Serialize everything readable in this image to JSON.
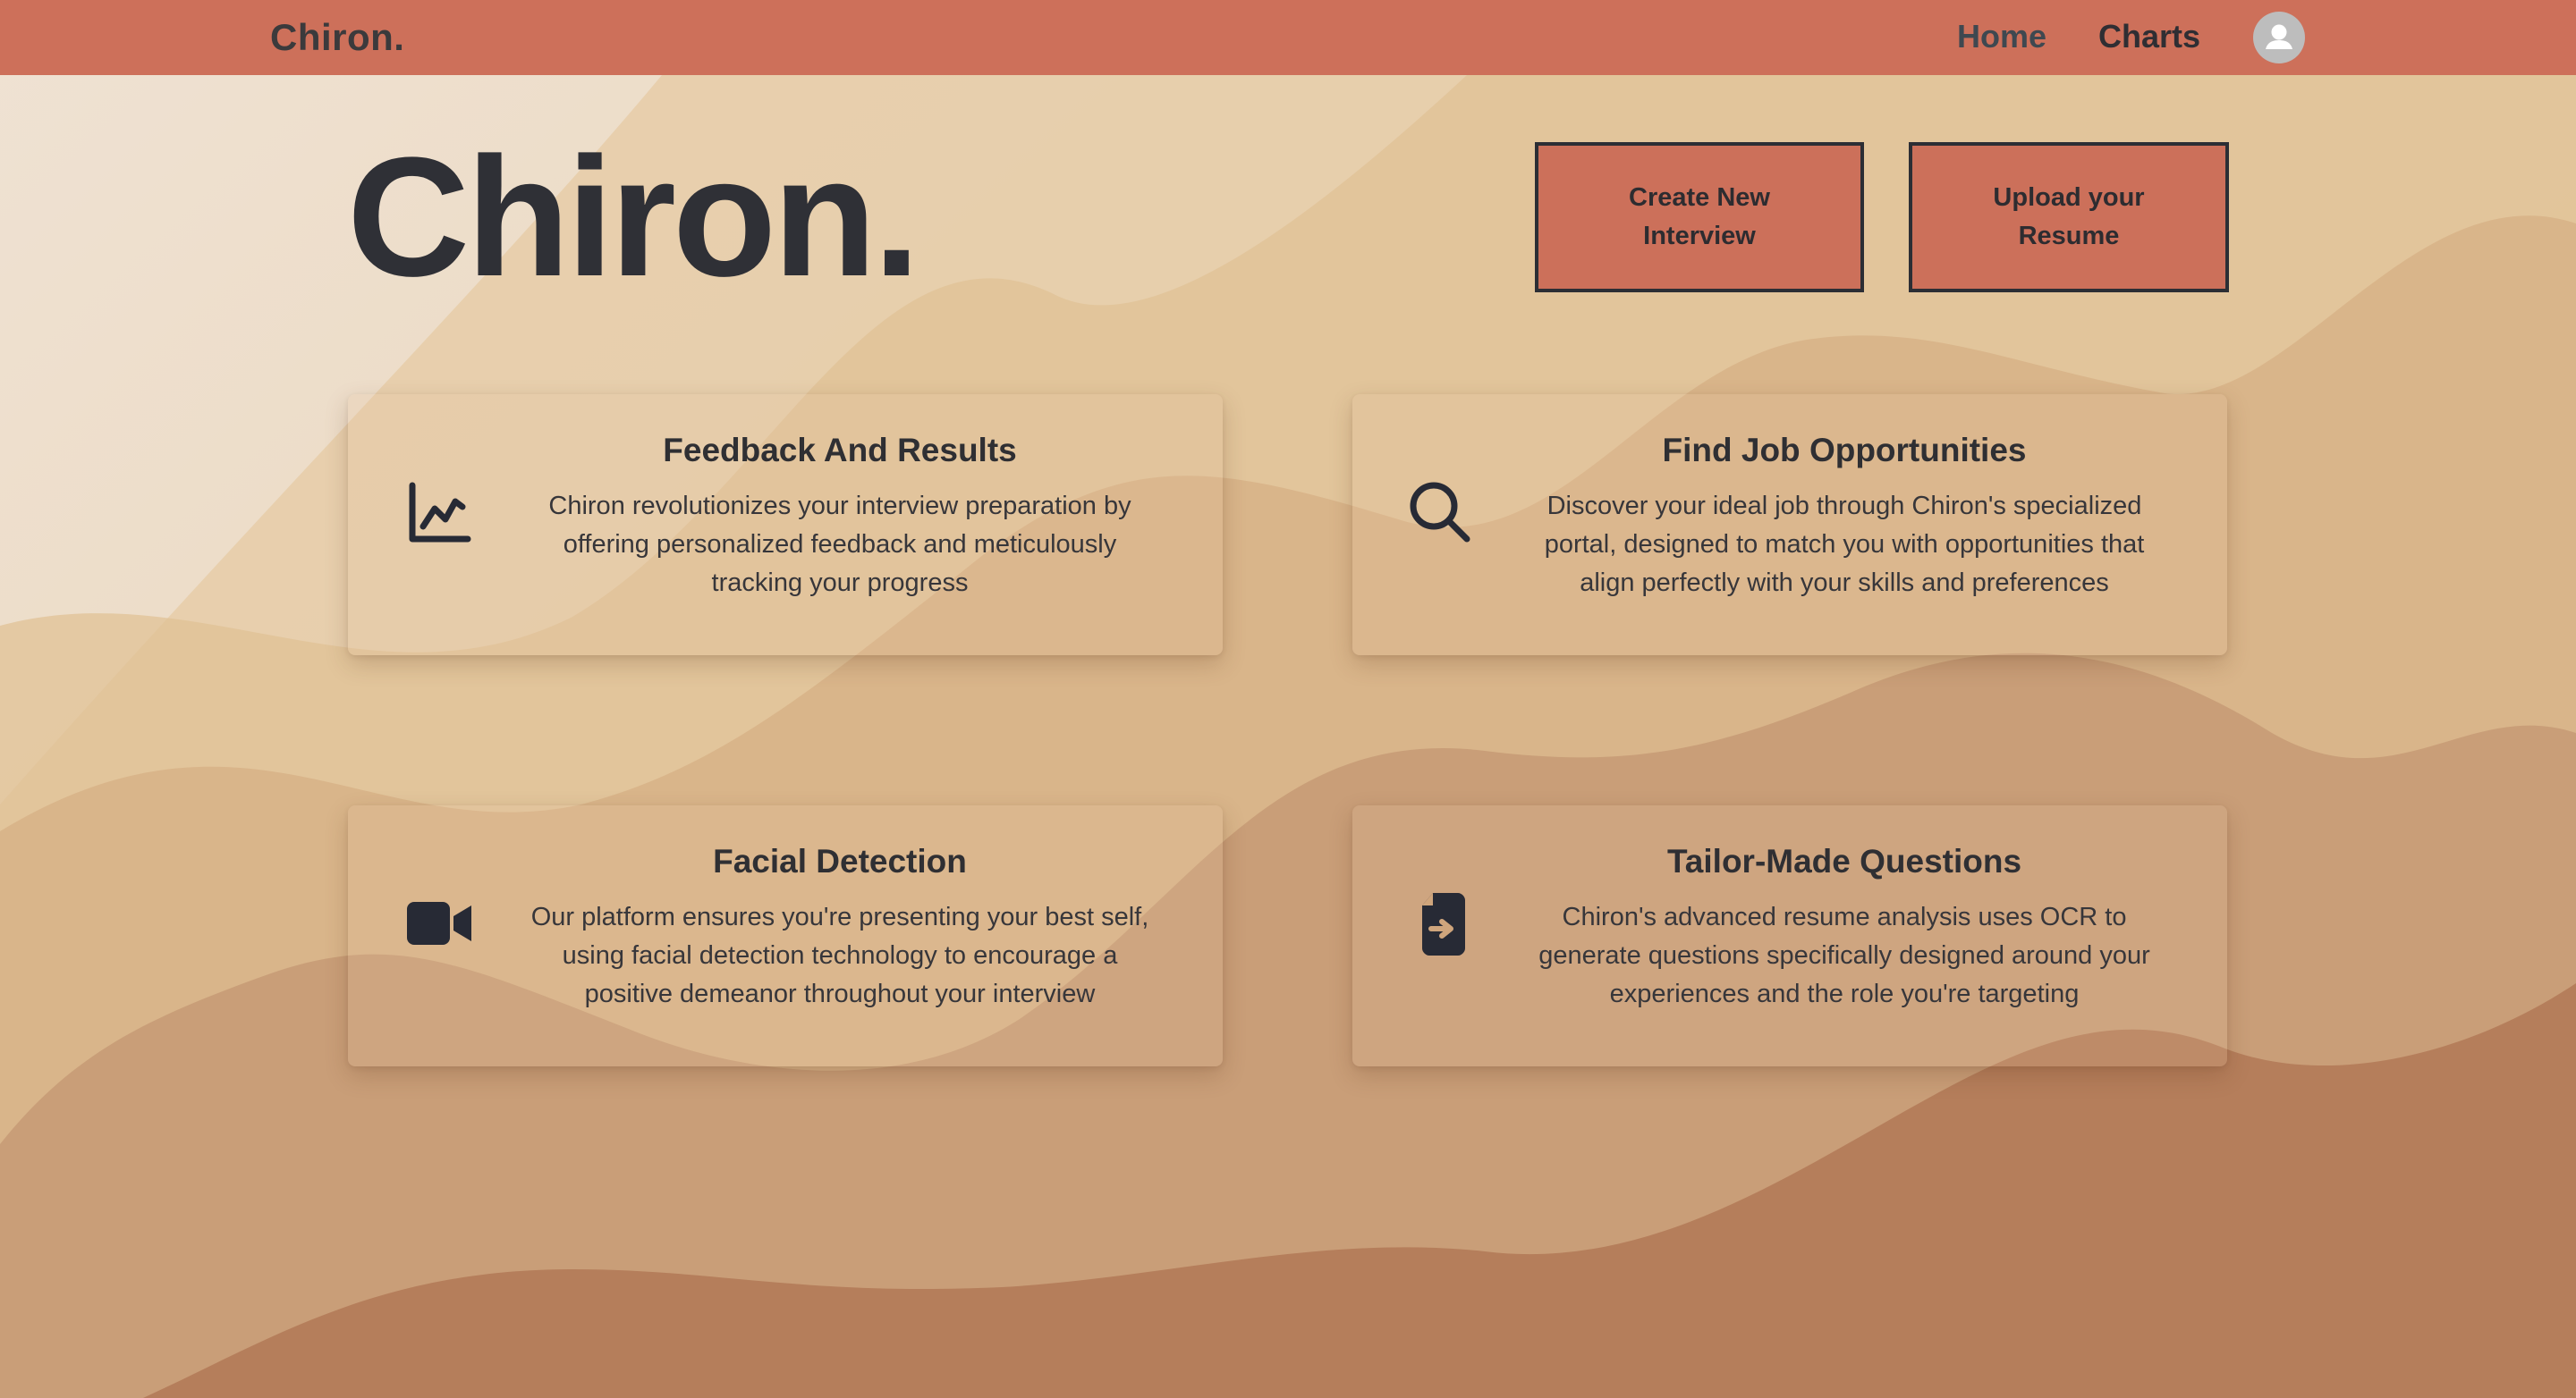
{
  "navbar": {
    "brand": "Chiron.",
    "links": [
      {
        "label": "Home"
      },
      {
        "label": "Charts"
      }
    ],
    "avatar_icon": "user-icon"
  },
  "hero": {
    "title": "Chiron.",
    "buttons": {
      "create": {
        "line1": "Create New",
        "line2": "Interview"
      },
      "upload": {
        "line1": "Upload your",
        "line2": "Resume"
      }
    }
  },
  "features": [
    {
      "icon": "chart-line-icon",
      "title": "Feedback And Results",
      "text": "Chiron revolutionizes your interview preparation by offering personalized feedback and meticulously tracking your progress"
    },
    {
      "icon": "search-icon",
      "title": "Find Job Opportunities",
      "text": "Discover your ideal job through Chiron's specialized portal, designed to match you with opportunities that align perfectly with your skills and preferences"
    },
    {
      "icon": "video-camera-icon",
      "title": "Facial Detection",
      "text": "Our platform ensures you're presenting your best self, using facial detection technology to encourage a positive demeanor throughout your interview"
    },
    {
      "icon": "file-import-icon",
      "title": "Tailor-Made Questions",
      "text": "Chiron's advanced resume analysis uses OCR to generate questions specifically designed around your experiences and the role you're targeting"
    }
  ],
  "colors": {
    "navbar": "#cd705a",
    "button_fill": "#cc705a",
    "text_dark": "#2f3036",
    "home_link": "#3f4850",
    "bg_light": "#ecdccb",
    "bg_dark": "#ae7352"
  }
}
